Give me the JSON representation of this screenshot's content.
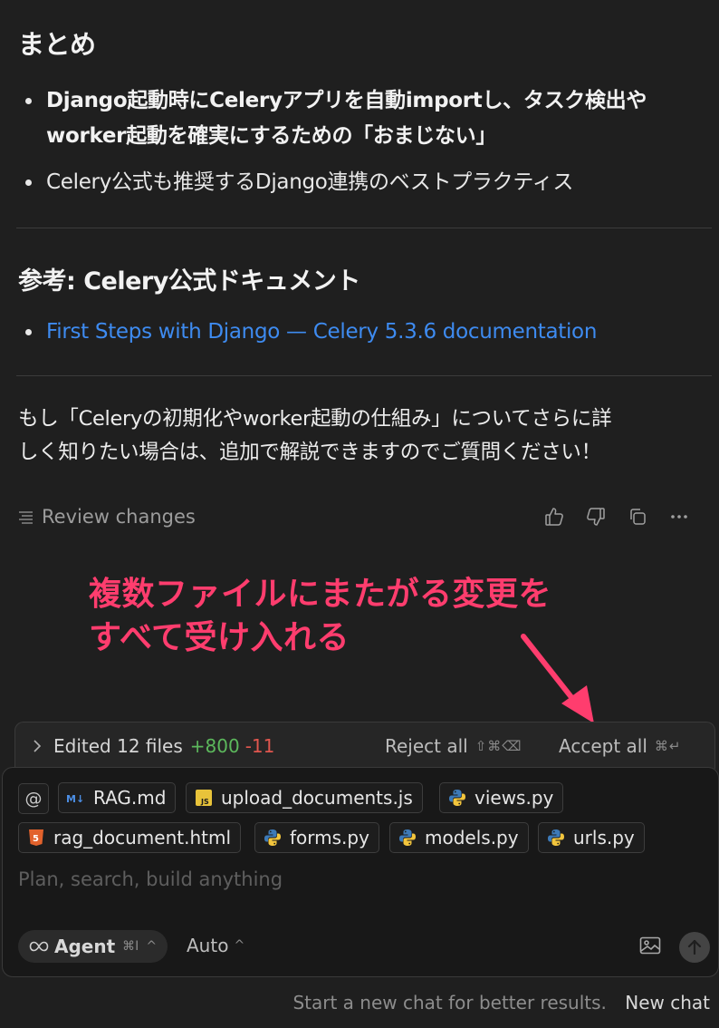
{
  "summary": {
    "heading": "まとめ",
    "bullet1_line1": "Django起動時にCeleryアプリを自動importし、タスク検出や",
    "bullet1_line2": "worker起動を確実にするための「おまじない」",
    "bullet2": "Celery公式も推奨するDjango連携のベストプラクティス"
  },
  "reference": {
    "heading": "参考: Celery公式ドキュメント",
    "link_text": "First Steps with Django — Celery 5.3.6 documentation"
  },
  "followup": {
    "line1": "もし「Celeryの初期化やworker起動の仕組み」についてさらに詳",
    "line2": "しく知りたい場合は、追加で解説できますのでご質問ください！"
  },
  "review": {
    "label": "Review changes"
  },
  "annotation": {
    "line1": "複数ファイルにまたがる変更を",
    "line2": "すべて受け入れる"
  },
  "edits": {
    "label": "Edited 12 files",
    "added": "+800",
    "removed": "-11",
    "reject_label": "Reject all",
    "reject_shortcut": "⇧⌘⌫",
    "accept_label": "Accept all",
    "accept_shortcut": "⌘↵"
  },
  "composer": {
    "at_symbol": "@",
    "files": [
      "RAG.md",
      "upload_documents.js",
      "views.py",
      "rag_document.html",
      "forms.py",
      "models.py",
      "urls.py"
    ],
    "placeholder": "Plan, search, build anything",
    "mode_label": "Agent",
    "mode_shortcut": "⌘I",
    "model_label": "Auto"
  },
  "footer": {
    "hint": "Start a new chat for better results.",
    "new_chat": "New chat"
  },
  "colors": {
    "link": "#3e8bf0",
    "annotation": "#ff3d6e",
    "added": "#5cb85c",
    "removed": "#e0564e"
  }
}
